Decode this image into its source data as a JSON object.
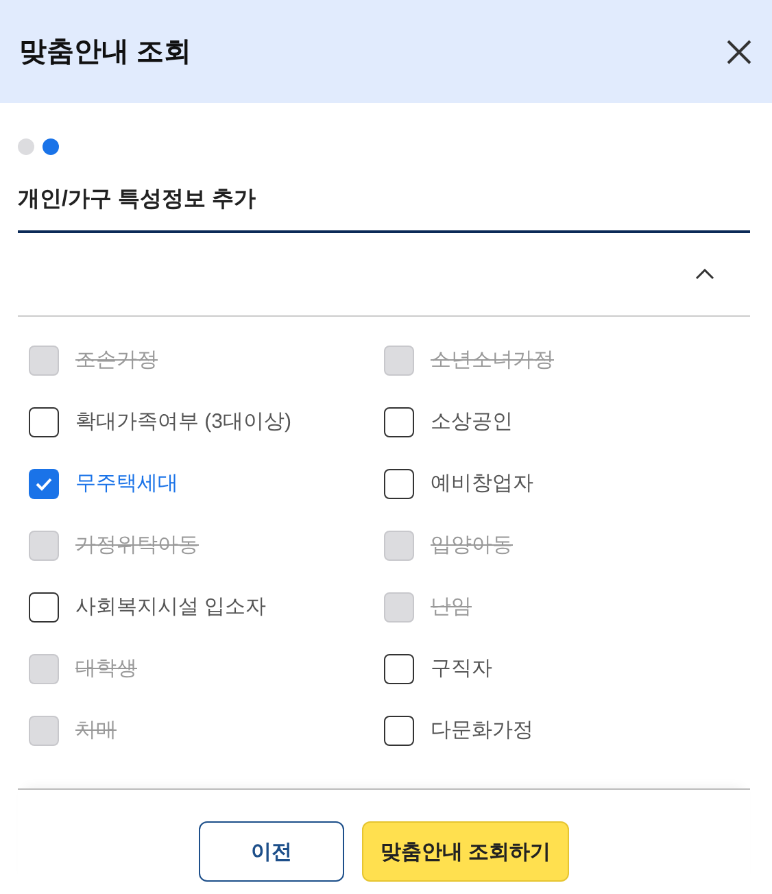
{
  "dialog": {
    "title": "맞춤안내 조회"
  },
  "steps": [
    {
      "selected": false
    },
    {
      "selected": true
    }
  ],
  "section": {
    "title": "개인/가구 특성정보 추가",
    "expanded": true
  },
  "options": [
    {
      "label": "조손가정",
      "checked": false,
      "disabled": true
    },
    {
      "label": "소년소녀가정",
      "checked": false,
      "disabled": true
    },
    {
      "label": "확대가족여부 (3대이상)",
      "checked": false,
      "disabled": false
    },
    {
      "label": "소상공인",
      "checked": false,
      "disabled": false
    },
    {
      "label": "무주택세대",
      "checked": true,
      "disabled": false
    },
    {
      "label": "예비창업자",
      "checked": false,
      "disabled": false
    },
    {
      "label": "가정위탁아동",
      "checked": false,
      "disabled": true
    },
    {
      "label": "입양아동",
      "checked": false,
      "disabled": true
    },
    {
      "label": "사회복지시설 입소자",
      "checked": false,
      "disabled": false
    },
    {
      "label": "난임",
      "checked": false,
      "disabled": true
    },
    {
      "label": "대학생",
      "checked": false,
      "disabled": true
    },
    {
      "label": "구직자",
      "checked": false,
      "disabled": false
    },
    {
      "label": "치매",
      "checked": false,
      "disabled": true
    },
    {
      "label": "다문화가정",
      "checked": false,
      "disabled": false
    }
  ],
  "buttons": [
    {
      "kind": "secondary",
      "label": "이전"
    },
    {
      "kind": "primary",
      "label": "맞춤안내 조회하기"
    }
  ]
}
